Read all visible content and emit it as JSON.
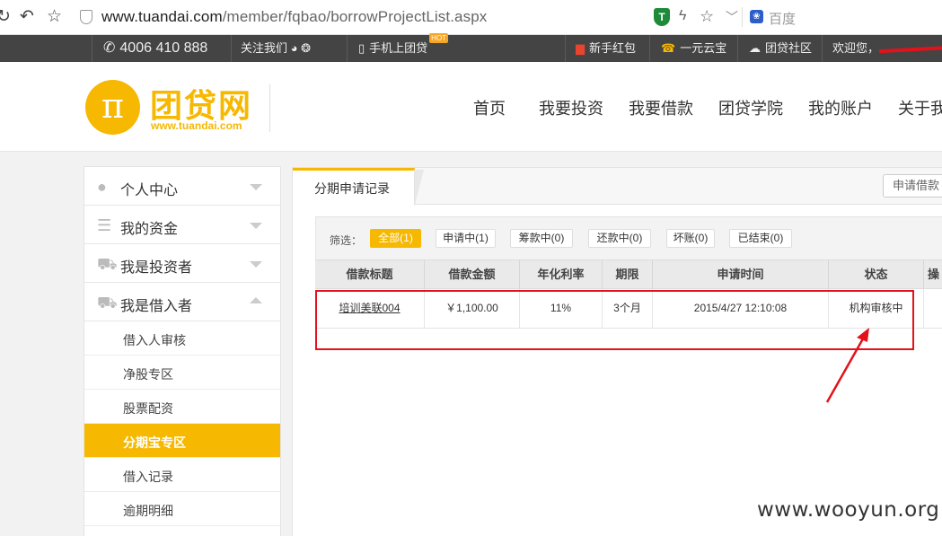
{
  "browser": {
    "url_host": "www.tuandai.com",
    "url_path": "/member/fqbao/borrowProjectList.aspx",
    "search_engine": "百度"
  },
  "topbar": {
    "phone": "4006 410 888",
    "follow": "关注我们",
    "mobile": "手机上团贷",
    "hot": "HOT",
    "red_packet": "新手红包",
    "yuan_bao": "一元云宝",
    "community": "团贷社区",
    "welcome": "欢迎您，"
  },
  "header": {
    "logo_cn": "团贷网",
    "logo_en": "www.tuandai.com",
    "logo_symbol": "π",
    "nav": [
      "首页",
      "我要投资",
      "我要借款",
      "团贷学院",
      "我的账户",
      "关于我"
    ]
  },
  "sidebar": {
    "sections": [
      {
        "label": "个人中心",
        "icon": "user-icon"
      },
      {
        "label": "我的资金",
        "icon": "coins-icon"
      },
      {
        "label": "我是投资者",
        "icon": "cart-icon"
      },
      {
        "label": "我是借入者",
        "icon": "cart-icon"
      }
    ],
    "sub_items": [
      "借入人审核",
      "净股专区",
      "股票配资",
      "分期宝专区",
      "借入记录",
      "逾期明细"
    ],
    "active_sub": "分期宝专区"
  },
  "main": {
    "tab": "分期申请记录",
    "apply_button": "申请借款",
    "filter_label": "筛选：",
    "filters": [
      "全部(1)",
      "申请中(1)",
      "筹款中(0)",
      "还款中(0)",
      "坏账(0)",
      "已结束(0)"
    ],
    "table": {
      "headers": [
        "借款标题",
        "借款金额",
        "年化利率",
        "期限",
        "申请时间",
        "状态",
        "操"
      ],
      "rows": [
        [
          "培训美联004",
          "￥1,100.00",
          "11%",
          "3个月",
          "2015/4/27 12:10:08",
          "机构审核中",
          ""
        ]
      ]
    }
  },
  "watermark": "www.wooyun.org",
  "colors": {
    "accent": "#f6b800",
    "annotation": "#e3121a",
    "topbar": "#444444"
  }
}
